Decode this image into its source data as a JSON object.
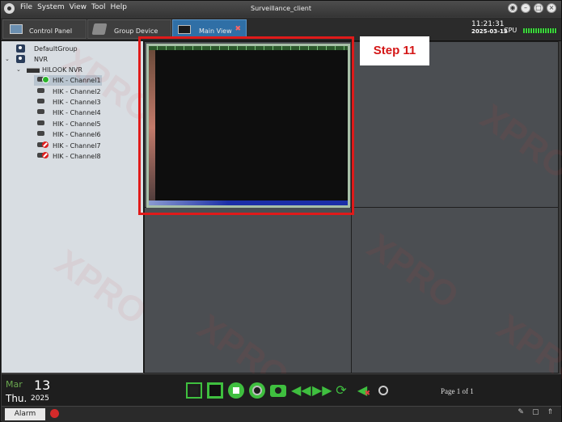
{
  "window": {
    "title": "Surveillance_client",
    "menu": [
      "File",
      "System",
      "View",
      "Tool",
      "Help"
    ],
    "controls": [
      "min-icon",
      "restore-icon",
      "fullscreen-icon",
      "close-icon"
    ]
  },
  "tabs": [
    {
      "label": "Control Panel",
      "icon": "control-panel-icon",
      "active": false
    },
    {
      "label": "Group Device",
      "icon": "group-device-icon",
      "active": false
    },
    {
      "label": "Main View",
      "icon": "main-view-icon",
      "active": true
    }
  ],
  "status": {
    "time": "11:21:31",
    "date": "2025-03-13",
    "cpu_label": "CPU"
  },
  "tree": {
    "default_group": "DefaultGroup",
    "nvr": "NVR",
    "hilook": "HILOOK NVR",
    "channels": [
      {
        "label": "HIK - Channel1",
        "status": "online",
        "selected": true
      },
      {
        "label": "HIK - Channel2",
        "status": "none"
      },
      {
        "label": "HIK - Channel3",
        "status": "none"
      },
      {
        "label": "HIK - Channel4",
        "status": "none"
      },
      {
        "label": "HIK - Channel5",
        "status": "none"
      },
      {
        "label": "HIK - Channel6",
        "status": "none"
      },
      {
        "label": "HIK - Channel7",
        "status": "error"
      },
      {
        "label": "HIK - Channel8",
        "status": "error"
      }
    ]
  },
  "annotation": {
    "step_label": "Step 11",
    "color": "#e01a1a"
  },
  "calendar": {
    "month": "Mar",
    "day": "13",
    "weekday": "Thu.",
    "year": "2025"
  },
  "toolbar": {
    "icons": [
      "fullscreen-icon",
      "single-view-icon",
      "stop-icon",
      "record-icon",
      "snapshot-icon",
      "rewind-icon",
      "fast-forward-icon",
      "refresh-icon",
      "mute-icon",
      "help-icon"
    ],
    "page_info": "Page 1 of 1"
  },
  "statusbar": {
    "alarm_tab": "Alarm"
  },
  "colors": {
    "accent": "#3fbf3f",
    "selected_tab": "#2f6fa6",
    "highlight": "#e01a1a"
  }
}
